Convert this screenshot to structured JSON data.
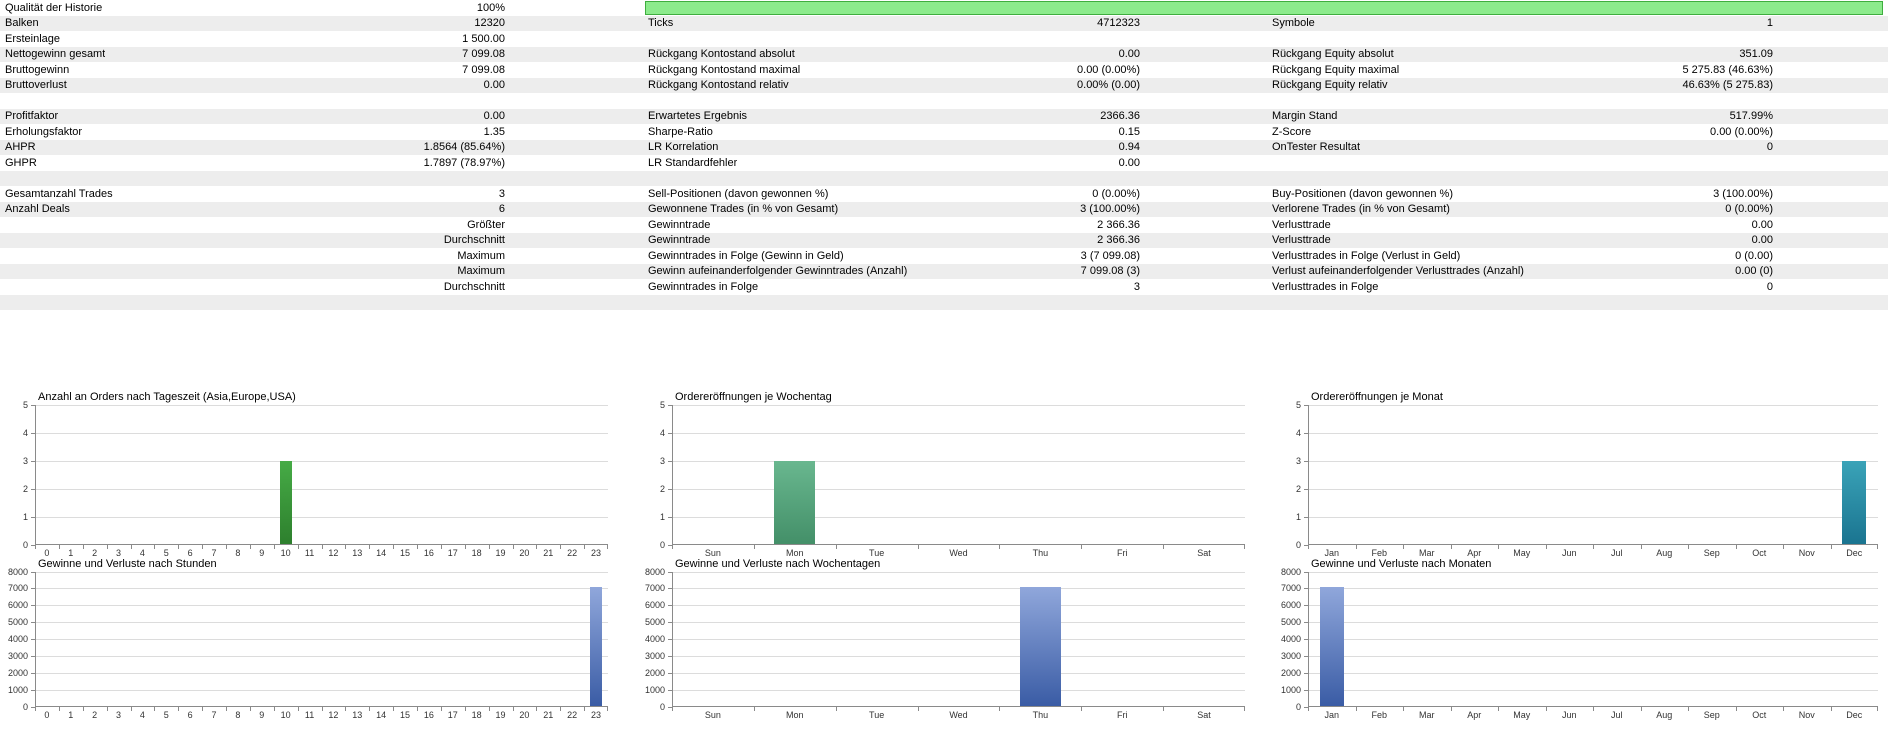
{
  "stats": {
    "history_quality_bar": {
      "percent": 100,
      "fill": "#8ceb8c",
      "border": "#3fae3f"
    },
    "rows": [
      {
        "c1l": "Qualität der Historie",
        "c1v": "100%",
        "bar": true
      },
      {
        "c1l": "Balken",
        "c1v": "12320",
        "c2l": "Ticks",
        "c2v": "4712323",
        "c3l": "Symbole",
        "c3v": "1"
      },
      {
        "c1l": "Ersteinlage",
        "c1v": "1 500.00"
      },
      {
        "c1l": "Nettogewinn gesamt",
        "c1v": "7 099.08",
        "c2l": "Rückgang Kontostand absolut",
        "c2v": "0.00",
        "c3l": "Rückgang Equity absolut",
        "c3v": "351.09"
      },
      {
        "c1l": "Bruttogewinn",
        "c1v": "7 099.08",
        "c2l": "Rückgang Kontostand maximal",
        "c2v": "0.00 (0.00%)",
        "c3l": "Rückgang Equity maximal",
        "c3v": "5 275.83 (46.63%)"
      },
      {
        "c1l": "Bruttoverlust",
        "c1v": "0.00",
        "c2l": "Rückgang Kontostand relativ",
        "c2v": "0.00% (0.00)",
        "c3l": "Rückgang Equity relativ",
        "c3v": "46.63% (5 275.83)"
      },
      {},
      {
        "c1l": "Profitfaktor",
        "c1v": "0.00",
        "c2l": "Erwartetes Ergebnis",
        "c2v": "2366.36",
        "c3l": "Margin Stand",
        "c3v": "517.99%"
      },
      {
        "c1l": "Erholungsfaktor",
        "c1v": "1.35",
        "c2l": "Sharpe-Ratio",
        "c2v": "0.15",
        "c3l": "Z-Score",
        "c3v": "0.00 (0.00%)"
      },
      {
        "c1l": "AHPR",
        "c1v": "1.8564 (85.64%)",
        "c2l": "LR Korrelation",
        "c2v": "0.94",
        "c3l": "OnTester Resultat",
        "c3v": "0"
      },
      {
        "c1l": "GHPR",
        "c1v": "1.7897 (78.97%)",
        "c2l": "LR Standardfehler",
        "c2v": "0.00"
      },
      {},
      {
        "c1l": "Gesamtanzahl Trades",
        "c1v": "3",
        "c2l": "Sell-Positionen (davon gewonnen %)",
        "c2v": "0 (0.00%)",
        "c3l": "Buy-Positionen (davon gewonnen %)",
        "c3v": "3 (100.00%)"
      },
      {
        "c1l": "Anzahl Deals",
        "c1v": "6",
        "c2l": "Gewonnene Trades (in % von Gesamt)",
        "c2v": "3 (100.00%)",
        "c3l": "Verlorene Trades (in % von Gesamt)",
        "c3v": "0 (0.00%)"
      },
      {
        "c1v": "Größter",
        "c2l": "Gewinntrade",
        "c2v": "2 366.36",
        "c3l": "Verlusttrade",
        "c3v": "0.00"
      },
      {
        "c1v": "Durchschnitt",
        "c2l": "Gewinntrade",
        "c2v": "2 366.36",
        "c3l": "Verlusttrade",
        "c3v": "0.00"
      },
      {
        "c1v": "Maximum",
        "c2l": "Gewinntrades in Folge (Gewinn in Geld)",
        "c2v": "3 (7 099.08)",
        "c3l": "Verlusttrades in Folge (Verlust in Geld)",
        "c3v": "0 (0.00)"
      },
      {
        "c1v": "Maximum",
        "c2l": "Gewinn aufeinanderfolgender Gewinntrades (Anzahl)",
        "c2v": "7 099.08 (3)",
        "c3l": "Verlust aufeinanderfolgender Verlusttrades (Anzahl)",
        "c3v": "0.00 (0)"
      },
      {
        "c1v": "Durchschnitt",
        "c2l": "Gewinntrades in Folge",
        "c2v": "3",
        "c3l": "Verlusttrades in Folge",
        "c3v": "0"
      },
      {},
      {}
    ]
  },
  "chart_data": [
    {
      "id": "orders-by-hour-chart",
      "type": "bar",
      "title": "Anzahl an Orders nach Tageszeit (Asia,Europe,USA)",
      "categories": [
        "0",
        "1",
        "2",
        "3",
        "4",
        "5",
        "6",
        "7",
        "8",
        "9",
        "10",
        "11",
        "12",
        "13",
        "14",
        "15",
        "16",
        "17",
        "18",
        "19",
        "20",
        "21",
        "22",
        "23"
      ],
      "values": [
        0,
        0,
        0,
        0,
        0,
        0,
        0,
        0,
        0,
        0,
        3,
        0,
        0,
        0,
        0,
        0,
        0,
        0,
        0,
        0,
        0,
        0,
        0,
        0
      ],
      "ylim": [
        0,
        5
      ],
      "ytick_step": 1,
      "grid": true,
      "legend": "none",
      "bar_color_top": "#46ab46",
      "bar_color_bottom": "#2d7f2d"
    },
    {
      "id": "orders-by-weekday-chart",
      "type": "bar",
      "title": "Ordereröffnungen je Wochentag",
      "categories": [
        "Sun",
        "Mon",
        "Tue",
        "Wed",
        "Thu",
        "Fri",
        "Sat"
      ],
      "values": [
        0,
        3,
        0,
        0,
        0,
        0,
        0
      ],
      "ylim": [
        0,
        5
      ],
      "ytick_step": 1,
      "grid": true,
      "legend": "none",
      "bar_color_top": "#69b78f",
      "bar_color_bottom": "#438f68"
    },
    {
      "id": "orders-by-month-chart",
      "type": "bar",
      "title": "Ordereröffnungen je Monat",
      "categories": [
        "Jan",
        "Feb",
        "Mar",
        "Apr",
        "May",
        "Jun",
        "Jul",
        "Aug",
        "Sep",
        "Oct",
        "Nov",
        "Dec"
      ],
      "values": [
        0,
        0,
        0,
        0,
        0,
        0,
        0,
        0,
        0,
        0,
        0,
        3
      ],
      "ylim": [
        0,
        5
      ],
      "ytick_step": 1,
      "grid": true,
      "legend": "none",
      "bar_color_top": "#3aa3b8",
      "bar_color_bottom": "#1a7490"
    },
    {
      "id": "pnl-by-hour-chart",
      "type": "bar",
      "title": "Gewinne und Verluste nach Stunden",
      "categories": [
        "0",
        "1",
        "2",
        "3",
        "4",
        "5",
        "6",
        "7",
        "8",
        "9",
        "10",
        "11",
        "12",
        "13",
        "14",
        "15",
        "16",
        "17",
        "18",
        "19",
        "20",
        "21",
        "22",
        "23"
      ],
      "values": [
        0,
        0,
        0,
        0,
        0,
        0,
        0,
        0,
        0,
        0,
        0,
        0,
        0,
        0,
        0,
        0,
        0,
        0,
        0,
        0,
        0,
        0,
        0,
        7099.08
      ],
      "ylim": [
        0,
        8000
      ],
      "ytick_step": 1000,
      "grid": true,
      "legend": "none",
      "bar_color_top": "#90a7db",
      "bar_color_bottom": "#3a5ca5"
    },
    {
      "id": "pnl-by-weekday-chart",
      "type": "bar",
      "title": "Gewinne und Verluste nach Wochentagen",
      "categories": [
        "Sun",
        "Mon",
        "Tue",
        "Wed",
        "Thu",
        "Fri",
        "Sat"
      ],
      "values": [
        0,
        0,
        0,
        0,
        7099.08,
        0,
        0
      ],
      "ylim": [
        0,
        8000
      ],
      "ytick_step": 1000,
      "grid": true,
      "legend": "none",
      "bar_color_top": "#90a7db",
      "bar_color_bottom": "#3a5ca5"
    },
    {
      "id": "pnl-by-month-chart",
      "type": "bar",
      "title": "Gewinne und Verluste nach Monaten",
      "categories": [
        "Jan",
        "Feb",
        "Mar",
        "Apr",
        "May",
        "Jun",
        "Jul",
        "Aug",
        "Sep",
        "Oct",
        "Nov",
        "Dec"
      ],
      "values": [
        7099.08,
        0,
        0,
        0,
        0,
        0,
        0,
        0,
        0,
        0,
        0,
        0
      ],
      "ylim": [
        0,
        8000
      ],
      "ytick_step": 1000,
      "grid": true,
      "legend": "none",
      "bar_color_top": "#90a7db",
      "bar_color_bottom": "#3a5ca5"
    }
  ]
}
